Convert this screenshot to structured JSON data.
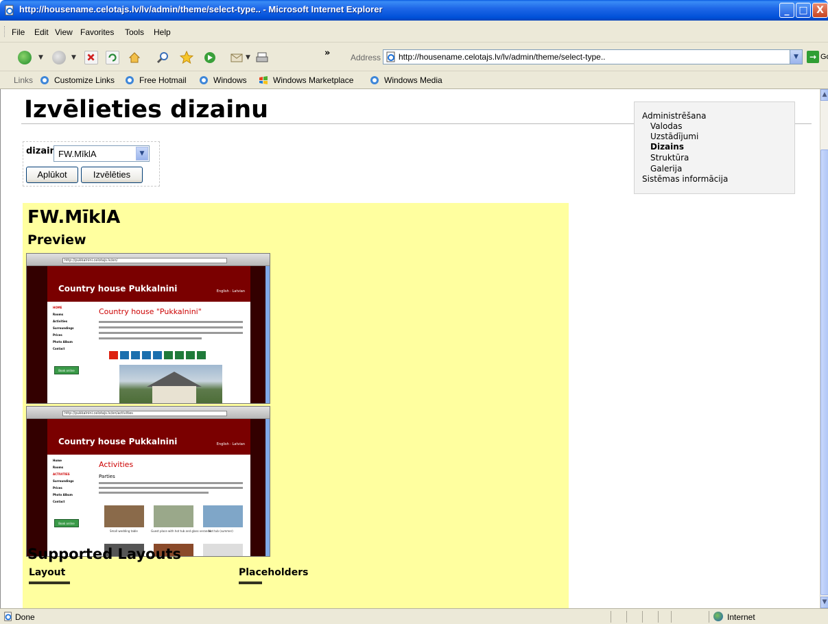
{
  "window": {
    "title": "http://housename.celotajs.lv/lv/admin/theme/select-type.. - Microsoft Internet Explorer",
    "min_label": "_",
    "max_label": "□",
    "close_label": "X"
  },
  "menu": {
    "items": [
      "File",
      "Edit",
      "View",
      "Favorites",
      "Tools",
      "Help"
    ]
  },
  "toolbar": {
    "address_label": "Address",
    "url": "http://housename.celotajs.lv/lv/admin/theme/select-type..",
    "go_label": "Go",
    "chevron": "»"
  },
  "links_bar": {
    "label": "Links",
    "items": [
      "Customize Links",
      "Free Hotmail",
      "Windows",
      "Windows Marketplace",
      "Windows Media"
    ]
  },
  "page": {
    "title": "Izvēlieties dizainu",
    "form": {
      "label": "dizains",
      "selected": "FW.MīklA",
      "apply_label": "Aplūkot",
      "choose_label": "Izvēlēties"
    },
    "side_menu": {
      "items": [
        {
          "label": "Administrēšana",
          "level": 0,
          "active": false
        },
        {
          "label": "Valodas",
          "level": 1,
          "active": false
        },
        {
          "label": "Uzstādījumi",
          "level": 1,
          "active": false
        },
        {
          "label": "Dizains",
          "level": 1,
          "active": true
        },
        {
          "label": "Struktūra",
          "level": 1,
          "active": false
        },
        {
          "label": "Galerija",
          "level": 1,
          "active": false
        },
        {
          "label": "Sistēmas informācija",
          "level": 0,
          "active": false
        }
      ]
    },
    "theme": {
      "name": "FW.MīklA",
      "preview_heading": "Preview",
      "shot1": {
        "url": "http://pukkalnini.celotajs.lv/en/",
        "site_title": "Country house Pukkalnini",
        "lang": "English · Latvian",
        "heading": "Country house \"Pukkalnini\"",
        "nav": [
          "HOME",
          "Rooms",
          "Activities",
          "Surroundings",
          "Prices",
          "Photo Album",
          "Contact"
        ],
        "book": "Book online"
      },
      "shot2": {
        "url": "http://pukkalnini.celotajs.lv/en/activities",
        "site_title": "Country house Pukkalnini",
        "lang": "English · Latvian",
        "heading": "Activities",
        "subheading": "Parties",
        "nav": [
          "Home",
          "Rooms",
          "ACTIVITIES",
          "Surroundings",
          "Prices",
          "Photo Album",
          "Contact"
        ],
        "book": "Book online",
        "captions": [
          "Small wedding table",
          "Guest place with hot tub and glass veranda",
          "Hot tub (summer)"
        ]
      },
      "supported_heading": "Supported Layouts",
      "col_layout": "Layout",
      "col_placeholders": "Placeholders"
    }
  },
  "status": {
    "text": "Done",
    "zone": "Internet"
  },
  "colors": {
    "panel": "#ffff9f",
    "title_bar": "#0050d8",
    "site_banner": "#7a0000"
  }
}
